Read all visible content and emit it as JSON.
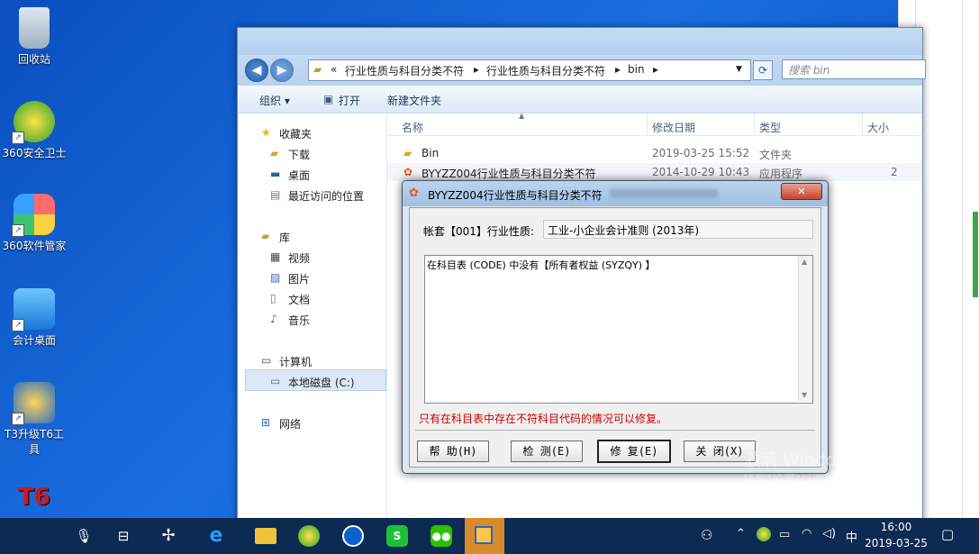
{
  "desktop": {
    "icons": [
      {
        "label": "回收站",
        "icon": "recycle-bin-icon"
      },
      {
        "label": "360安全卫士",
        "icon": "360-safe-icon"
      },
      {
        "label": "360软件管家",
        "icon": "360-software-manager-icon"
      },
      {
        "label": "会计桌面",
        "icon": "accounting-desktop-icon"
      },
      {
        "label": "T3升级T6工具",
        "icon": "t3-upgrade-icon"
      },
      {
        "label": "T6",
        "icon": "t6-icon"
      }
    ]
  },
  "explorer": {
    "breadcrumb": [
      "«",
      "行业性质与科目分类不符",
      "行业性质与科目分类不符",
      "bin"
    ],
    "search_placeholder": "搜索 bin",
    "toolbar": {
      "organize": "组织 ▾",
      "open": "打开",
      "new_folder": "新建文件夹"
    },
    "nav": {
      "favorites": "收藏夹",
      "downloads": "下载",
      "desktop": "桌面",
      "recent": "最近访问的位置",
      "libraries": "库",
      "videos": "视频",
      "pictures": "图片",
      "documents": "文档",
      "music": "音乐",
      "computer": "计算机",
      "local_disk": "本地磁盘 (C:)",
      "network": "网络"
    },
    "columns": {
      "name": "名称",
      "date": "修改日期",
      "type": "类型",
      "size": "大小"
    },
    "files": [
      {
        "name": "Bin",
        "date": "2019-03-25 15:52",
        "type": "文件夹",
        "size": ""
      },
      {
        "name": "BYYZZ004行业性质与科目分类不符",
        "date": "2014-10-29 10:43",
        "type": "应用程序",
        "size": "2"
      }
    ]
  },
  "dialog": {
    "title": "BYYZZ004行业性质与科目分类不符",
    "account_label": "帐套【001】行业性质:",
    "account_value": "工业-小企业会计准则 (2013年)",
    "message": "在科目表 (CODE) 中没有【所有者权益 (SYZQY) 】",
    "hint": "只有在科目表中存在不符科目代码的情况可以修复。",
    "buttons": {
      "help": "帮 助(H)",
      "check": "检 测(E)",
      "fix": "修 复(E)",
      "close": "关 闭(X)"
    },
    "colors": {
      "hint": "#cc0000"
    }
  },
  "watermark": {
    "line1": "激活 Windows",
    "line2": "转到\"设置\"以激活 Windows。"
  },
  "taskbar": {
    "time": "16:00",
    "date": "2019-03-25",
    "ime": "中"
  }
}
